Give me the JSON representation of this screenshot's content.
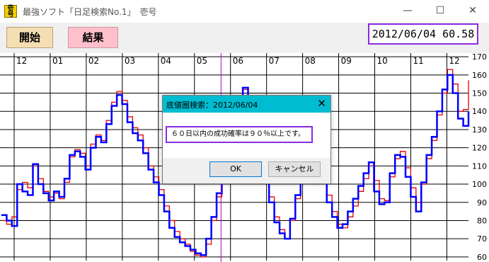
{
  "window": {
    "icon_label": "壱号",
    "title": "最強ソフト「日足検索No.1」　壱号",
    "minimize_glyph": "—",
    "maximize_glyph": "☐",
    "close_glyph": "✕"
  },
  "toolbar": {
    "start_label": "開始",
    "result_label": "結果",
    "readout": "2012/06/04 60.58"
  },
  "chart_data": {
    "type": "line",
    "x_tick_labels": [
      "12",
      "01",
      "02",
      "03",
      "04",
      "05",
      "06",
      "07",
      "08",
      "09",
      "10",
      "11",
      "12"
    ],
    "y_tick_labels": [
      "60",
      "70",
      "80",
      "90",
      "100",
      "110",
      "120",
      "130",
      "140",
      "150",
      "160",
      "170"
    ],
    "ylim": [
      58,
      172
    ],
    "series": [
      {
        "color": "#e00000",
        "values": [
          80,
          78,
          82,
          97,
          101,
          98,
          110,
          103,
          96,
          93,
          95,
          92,
          101,
          115,
          119,
          117,
          110,
          122,
          127,
          124,
          135,
          145,
          151,
          146,
          137,
          131,
          127,
          120,
          110,
          104,
          97,
          88,
          80,
          74,
          70,
          67,
          63,
          61,
          60,
          67,
          80,
          93,
          101,
          113,
          120,
          137,
          152,
          146,
          138,
          125,
          107,
          93,
          82,
          75,
          70,
          80,
          92,
          101,
          113,
          122,
          116,
          105,
          94,
          85,
          78,
          76,
          82,
          88,
          96,
          103,
          110,
          102,
          92,
          91,
          104,
          114,
          118,
          109,
          98,
          90,
          100,
          114,
          124,
          138,
          150,
          163,
          155,
          140,
          141,
          157
        ]
      },
      {
        "color": "#0000ff",
        "values": [
          83,
          80,
          77,
          100,
          96,
          94,
          111,
          100,
          95,
          91,
          96,
          93,
          103,
          116,
          118,
          115,
          108,
          120,
          126,
          123,
          133,
          143,
          149,
          144,
          134,
          128,
          124,
          117,
          108,
          101,
          94,
          85,
          76,
          71,
          68,
          66,
          64,
          62,
          61,
          70,
          82,
          95,
          103,
          115,
          122,
          139,
          153,
          144,
          135,
          122,
          104,
          90,
          79,
          73,
          70,
          81,
          94,
          103,
          115,
          118,
          112,
          101,
          90,
          82,
          76,
          78,
          85,
          92,
          99,
          106,
          112,
          96,
          89,
          90,
          106,
          116,
          115,
          104,
          93,
          85,
          101,
          116,
          126,
          140,
          152,
          160,
          150,
          136,
          132,
          140
        ]
      }
    ],
    "cursor_x_fraction": 0.452
  },
  "dialog": {
    "title": "底値圏検索：2012/06/04",
    "message": "６０日以内の成功確率は９０％以上です。",
    "ok_label": "OK",
    "cancel_label": "キャンセル",
    "close_glyph": "✕"
  }
}
